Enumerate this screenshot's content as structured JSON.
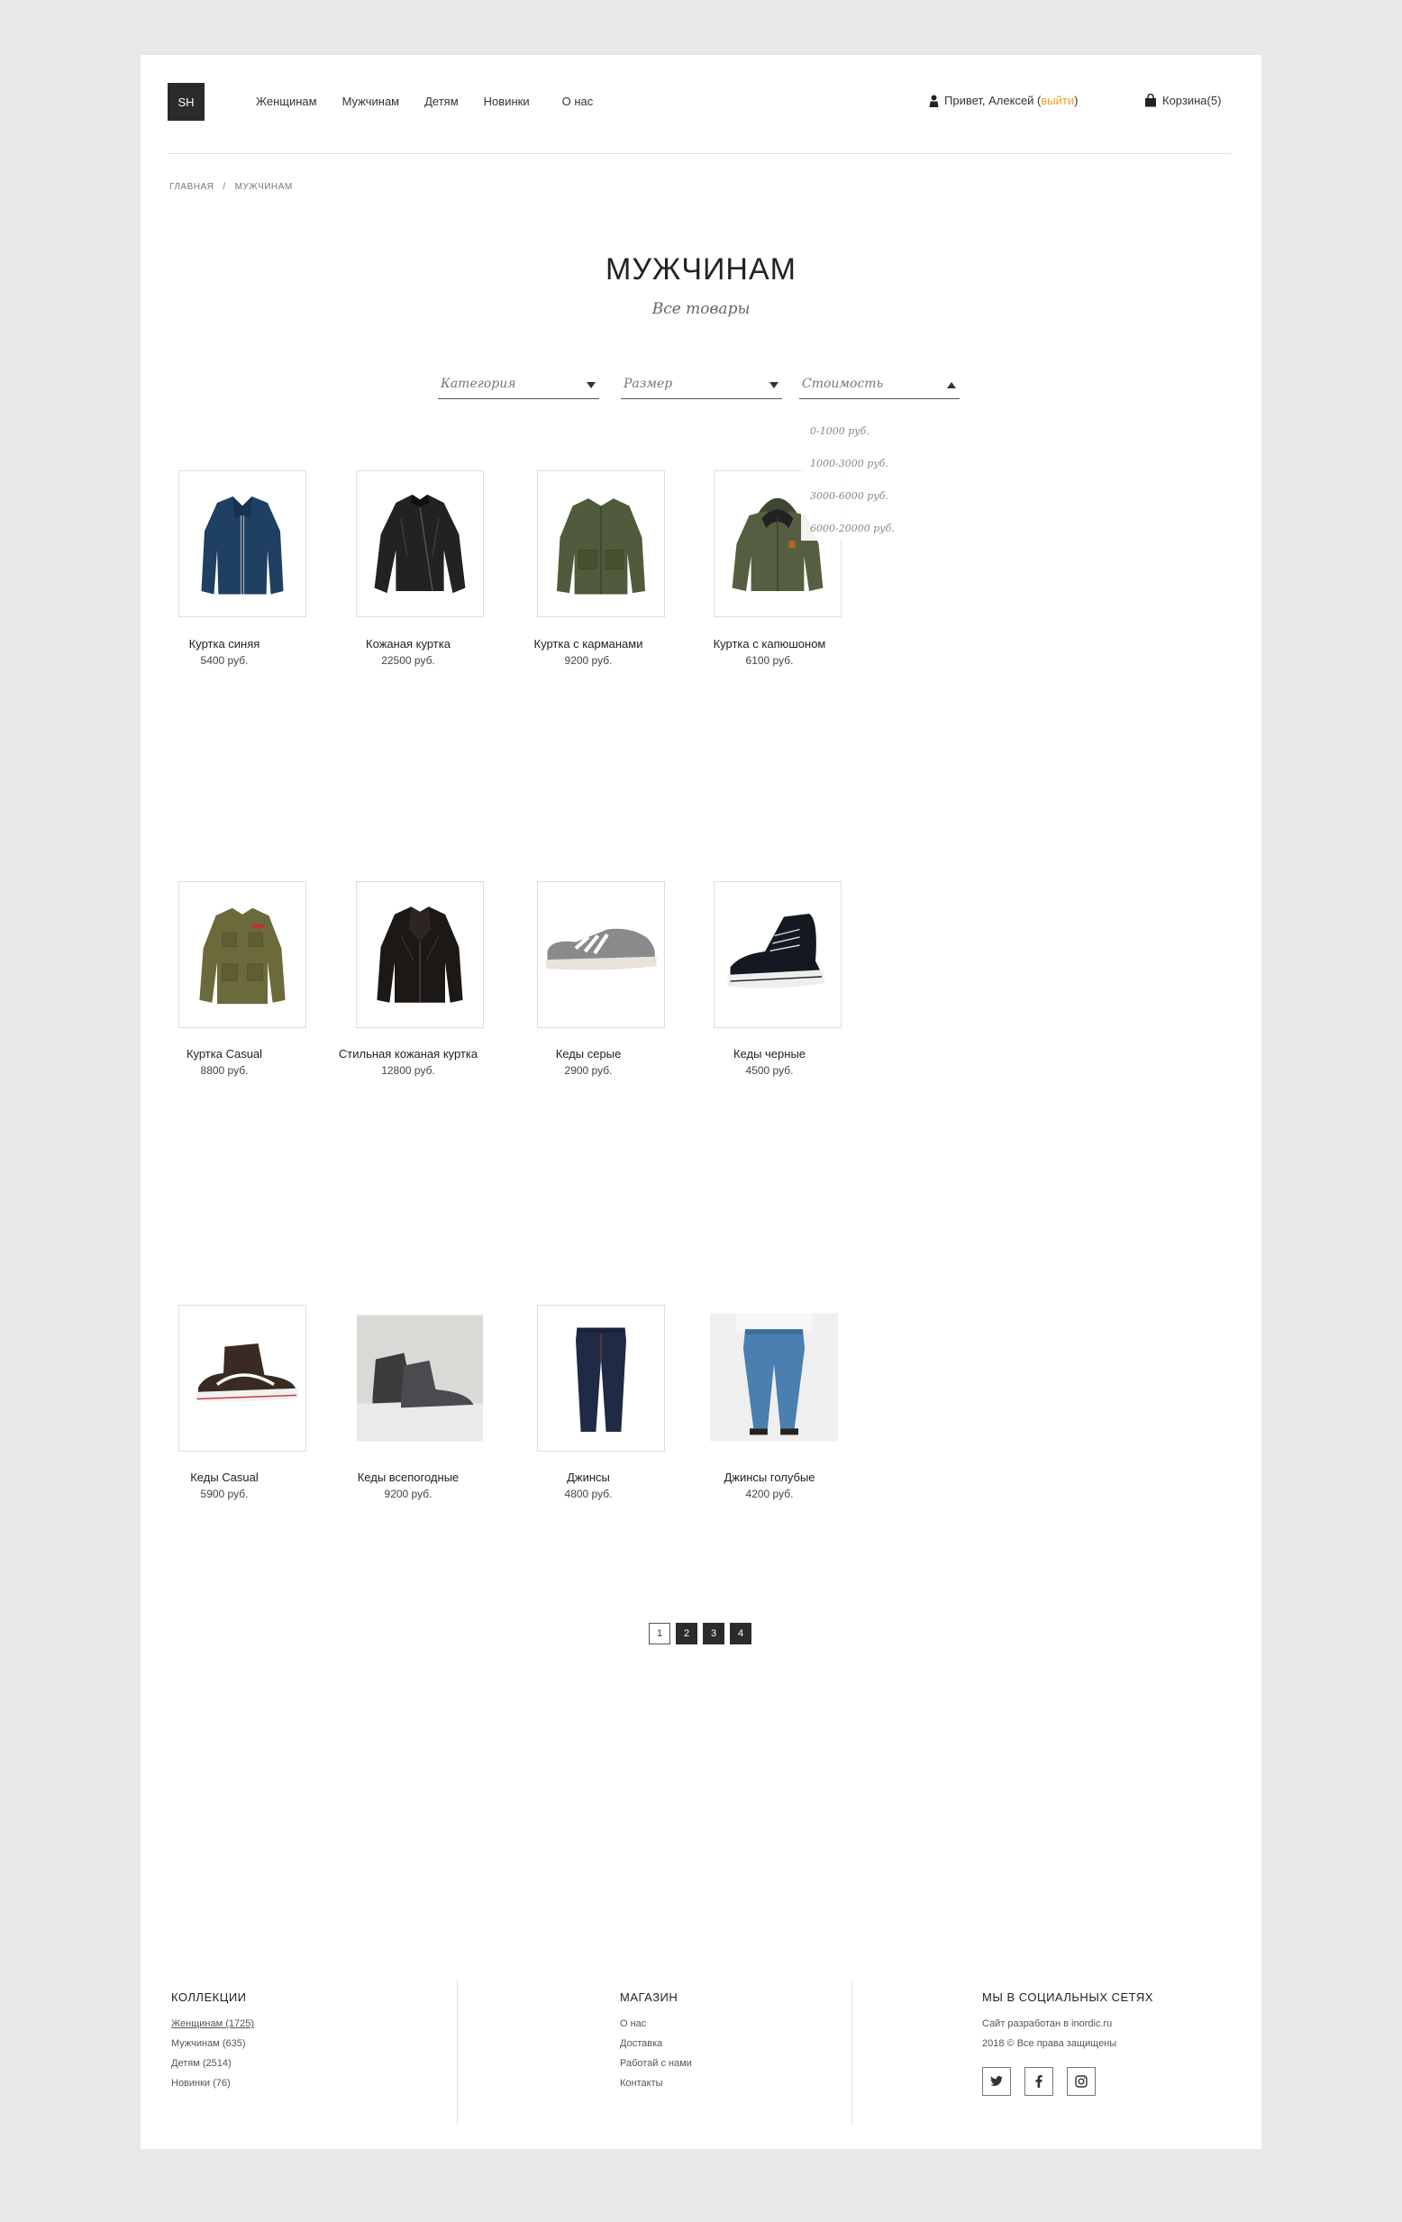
{
  "header": {
    "logo": "SH",
    "nav": [
      "Женщинам",
      "Мужчинам",
      "Детям",
      "Новинки",
      "О нас"
    ],
    "greeting": "Привет, Алексей (",
    "logout": "выйти",
    "greeting_close": ")",
    "cart": "Корзина(5)"
  },
  "breadcrumb": {
    "home": "ГЛАВНАЯ",
    "sep": "/",
    "current": "МУЖЧИНАМ"
  },
  "title": "МУЖЧИНАМ",
  "subtitle": "Все товары",
  "filters": {
    "category": "Категория",
    "size": "Размер",
    "price": "Стоимость",
    "price_options": [
      "0-1000 руб.",
      "1000-3000 руб.",
      "3000-6000 руб.",
      "6000-20000 руб."
    ]
  },
  "products": [
    {
      "name": "Куртка синяя",
      "price": "5400 руб.",
      "icon": "blue-jacket-image"
    },
    {
      "name": "Кожаная куртка",
      "price": "22500 руб.",
      "icon": "leather-jacket-image"
    },
    {
      "name": "Куртка с карманами",
      "price": "9200 руб.",
      "icon": "pocket-jacket-image"
    },
    {
      "name": "Куртка с капюшоном",
      "price": "6100 руб.",
      "icon": "hooded-jacket-image"
    },
    {
      "name": "Куртка Casual",
      "price": "8800 руб.",
      "icon": "casual-jacket-image"
    },
    {
      "name": "Стильная кожаная куртка",
      "price": "12800 руб.",
      "icon": "stylish-leather-jacket-image"
    },
    {
      "name": "Кеды серые",
      "price": "2900 руб.",
      "icon": "grey-sneakers-image"
    },
    {
      "name": "Кеды черные",
      "price": "4500 руб.",
      "icon": "black-sneakers-image"
    },
    {
      "name": "Кеды Casual",
      "price": "5900 руб.",
      "icon": "casual-sneakers-image"
    },
    {
      "name": "Кеды всепогодные",
      "price": "9200 руб.",
      "icon": "all-weather-boots-image"
    },
    {
      "name": "Джинсы",
      "price": "4800 руб.",
      "icon": "dark-jeans-image"
    },
    {
      "name": "Джинсы голубые",
      "price": "4200 руб.",
      "icon": "blue-jeans-image"
    }
  ],
  "pagination": [
    "1",
    "2",
    "3",
    "4"
  ],
  "footer": {
    "collections": {
      "title": "КОЛЛЕКЦИИ",
      "items": [
        "Женщинам (1725)",
        "Мужчинам (635)",
        "Детям (2514)",
        "Новинки (76)"
      ]
    },
    "shop": {
      "title": "МАГАЗИН",
      "items": [
        "О нас",
        "Доставка",
        "Работай с нами",
        "Контакты"
      ]
    },
    "social": {
      "title": "МЫ В СОЦИАЛЬНЫХ СЕТЯХ",
      "line1": "Сайт разработан в inordic.ru",
      "line2": "2018 © Все права защищены",
      "icons": [
        "twitter-icon",
        "facebook-icon",
        "instagram-icon"
      ]
    }
  },
  "colors": {
    "accent": "#f0a020",
    "dark": "#2b2b2b"
  }
}
